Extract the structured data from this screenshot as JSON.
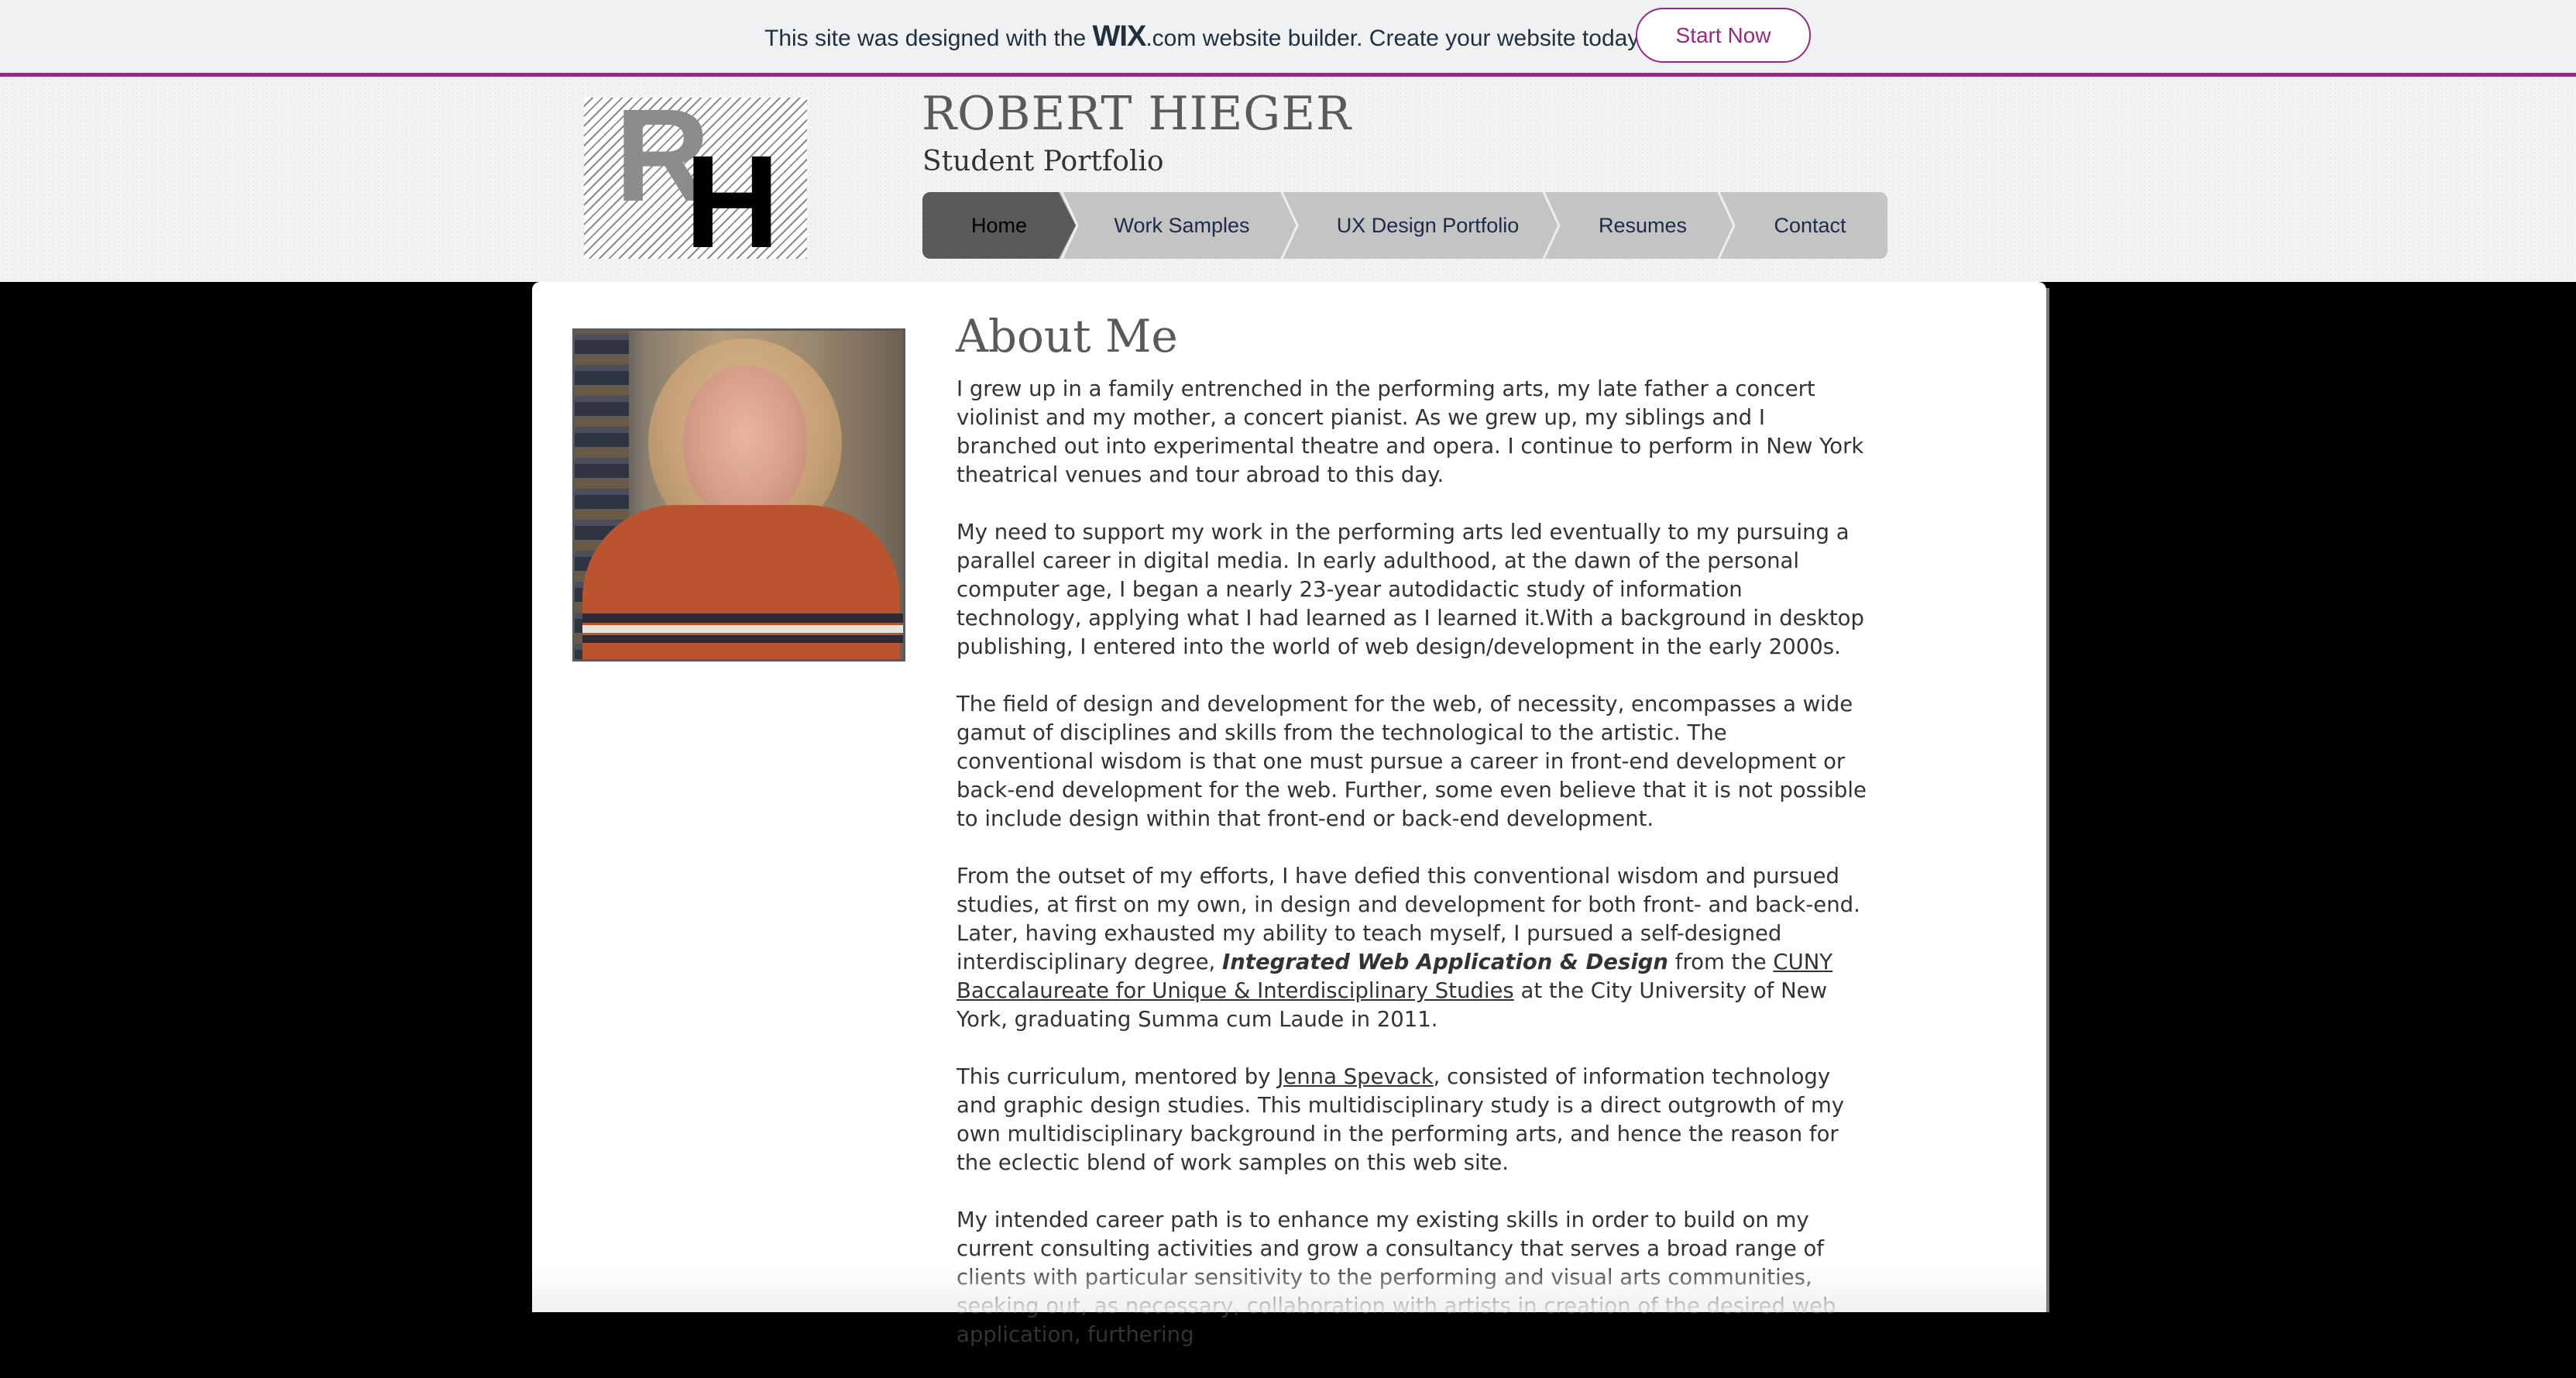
{
  "banner": {
    "prefix": "This site was designed with the ",
    "brand": "WIX",
    "brand_suffix": ".com",
    "suffix": " website builder. Create your website today.",
    "cta": "Start Now",
    "accent": "#942b83"
  },
  "header": {
    "logo_letters": [
      "R",
      "H"
    ],
    "title": "ROBERT HIEGER",
    "subtitle": "Student Portfolio"
  },
  "nav": {
    "items": [
      {
        "label": "Home",
        "active": true
      },
      {
        "label": "Work Samples",
        "active": false
      },
      {
        "label": "UX Design Portfolio",
        "active": false
      },
      {
        "label": "Resumes",
        "active": false
      },
      {
        "label": "Contact",
        "active": false
      }
    ]
  },
  "about": {
    "heading": "About Me",
    "p1": "I grew up in a family entrenched in the performing arts, my late father a concert violinist and my mother, a concert pianist. As we grew up, my siblings and I branched out into experimental theatre and opera. I continue to perform in New York theatrical venues and tour abroad to this day.",
    "p2": "My need to support my work in the performing arts led eventually to my pursuing a parallel career in digital media. In early adulthood, at the dawn of the personal computer age, I began a nearly 23-year autodidactic study of information technology, applying what I had learned as I learned it.With a background in desktop publishing, I entered into the world of web design/development in the early 2000s.",
    "p3": "The field of design and development for the web, of necessity, encompasses a wide gamut of disciplines and skills from the technological to the artistic. The conventional wisdom is that one must pursue a career in front-end development or back-end development for the web. Further, some even believe that it is not possible to include design within that front-end or back-end development.",
    "p4_a": "From the outset of my efforts, I have defied this conventional wisdom and pursued studies, at first on my own, in design and development for both front- and back-end. Later, having exhausted my ability to teach myself, I pursued a self-designed interdisciplinary degree, ",
    "p4_degree": "Integrated Web Application & Design",
    "p4_b": " from the ",
    "p4_link": "CUNY Baccalaureate for Unique & Interdisciplinary Studies",
    "p4_c": " at the City University of New York, graduating Summa cum Laude in 2011.",
    "p5_a": "This curriculum, mentored by ",
    "p5_link": "Jenna Spevack",
    "p5_b": ", consisted of information technology and graphic design studies. This multidisciplinary study is a direct outgrowth of my own multidisciplinary background in the performing arts, and hence the reason for the eclectic blend of work samples on this web site.",
    "p6": "My intended career path is to enhance my existing skills in order to build on my current consulting activities and grow a consultancy that serves a broad range of clients with particular sensitivity to the performing and visual arts communities, seeking out, as necessary, collaboration with artists in creation of the desired web application, furthering"
  }
}
